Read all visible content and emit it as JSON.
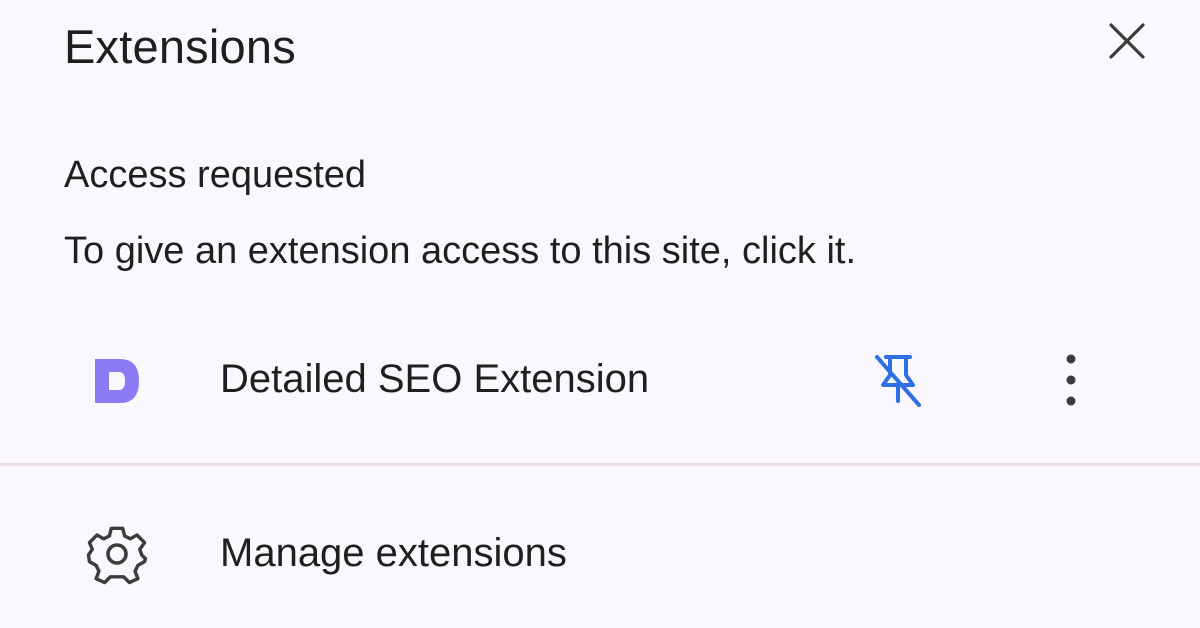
{
  "header": {
    "title": "Extensions",
    "close_icon": "close-icon"
  },
  "access_section": {
    "heading": "Access requested",
    "description": "To give an extension access to this site, click it."
  },
  "extensions": [
    {
      "name": "Detailed SEO Extension",
      "icon": "detailed-seo-logo",
      "icon_color": "#8b7cf6",
      "pin_icon": "unpin-icon",
      "pin_color": "#2f6fe4",
      "menu_icon": "more-vert-icon"
    }
  ],
  "footer": {
    "manage_label": "Manage extensions",
    "manage_icon": "gear-icon"
  },
  "colors": {
    "background": "#fbf8fd",
    "divider": "#ecdde8",
    "text": "#1f1f1f",
    "accent_blue": "#2f6fe4"
  }
}
